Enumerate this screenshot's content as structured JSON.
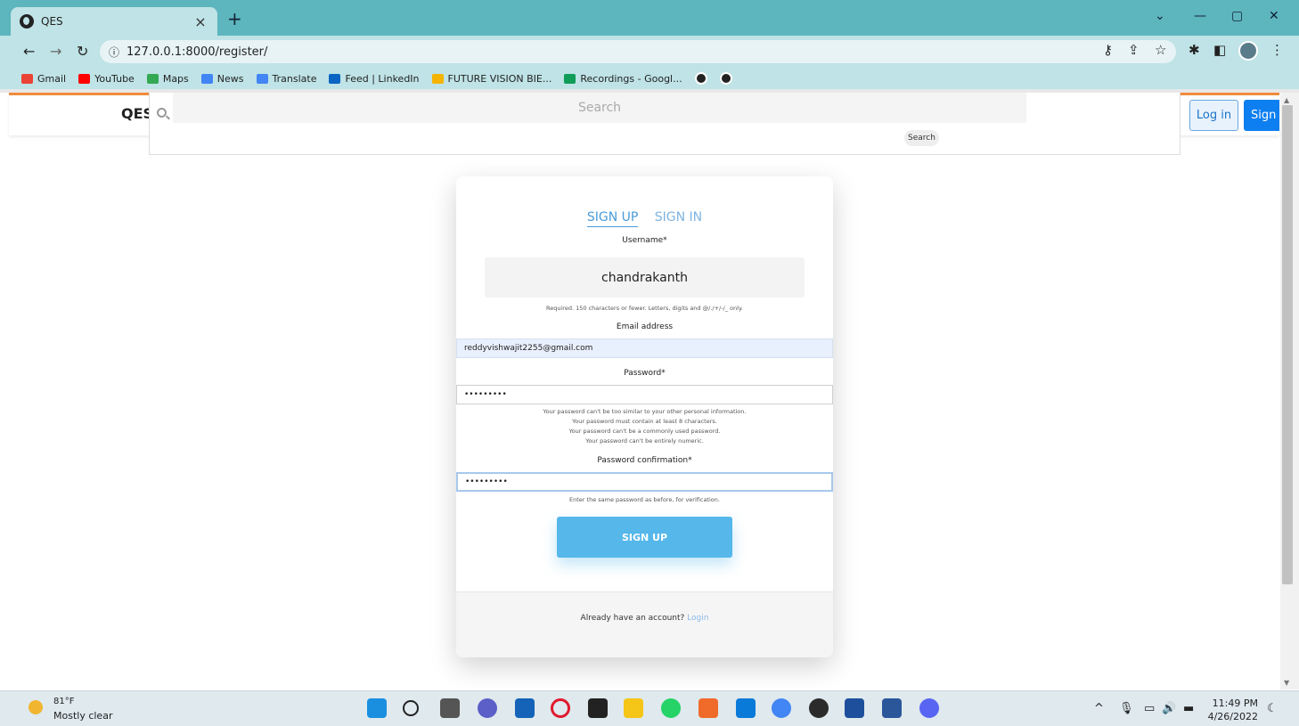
{
  "browser": {
    "tab_title": "QES",
    "tab_close": "×",
    "new_tab": "+",
    "url": "127.0.0.1:8000/register/",
    "bookmarks": [
      {
        "label": "Gmail",
        "color": "#ea4335"
      },
      {
        "label": "YouTube",
        "color": "#ff0000"
      },
      {
        "label": "Maps",
        "color": "#34a853"
      },
      {
        "label": "News",
        "color": "#4285f4"
      },
      {
        "label": "Translate",
        "color": "#4285f4"
      },
      {
        "label": "Feed | LinkedIn",
        "color": "#0a66c2"
      },
      {
        "label": "FUTURE VISION BIE...",
        "color": "#f4b400"
      },
      {
        "label": "Recordings - Googl...",
        "color": "#0f9d58"
      }
    ]
  },
  "header": {
    "brand": "QES",
    "search_placeholder": "Search",
    "search_button": "Search",
    "login_button": "Log in",
    "signup_button": "Sign"
  },
  "form": {
    "tabs": [
      {
        "label": "SIGN UP",
        "active": true
      },
      {
        "label": "SIGN IN",
        "active": false
      }
    ],
    "username_label": "Username*",
    "username_value": "chandrakanth",
    "username_help": "Required. 150 characters or fewer. Letters, digits and @/./+/-/_ only.",
    "email_label": "Email address",
    "email_value": "reddyvishwajit2255@gmail.com",
    "password_label": "Password*",
    "password_value": "•••••••••",
    "password_help": [
      "Your password can't be too similar to your other personal information.",
      "Your password must contain at least 8 characters.",
      "Your password can't be a commonly used password.",
      "Your password can't be entirely numeric."
    ],
    "confirm_label": "Password confirmation*",
    "confirm_value": "•••••••••",
    "confirm_help": "Enter the same password as before, for verification.",
    "submit": "SIGN UP",
    "footer_text": "Already have an account?",
    "footer_link": "Login"
  },
  "taskbar": {
    "temperature": "81°F",
    "weather": "Mostly clear",
    "time": "11:49 PM",
    "date": "4/26/2022"
  },
  "colors": {
    "accent": "#55b7ea",
    "header_border": "#f08b3a",
    "chrome": "#5db5be"
  }
}
